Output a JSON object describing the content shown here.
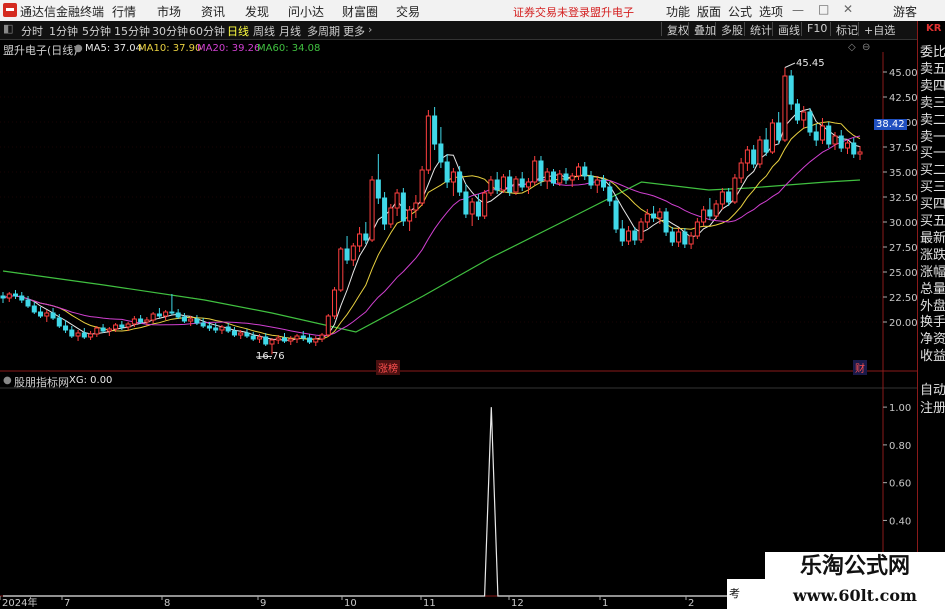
{
  "titlebar": {
    "app_name": "通达信金融终端",
    "menus": [
      "行情",
      "市场",
      "资讯",
      "发现",
      "问小达",
      "财富圈",
      "交易"
    ],
    "broker_notice": "证券交易未登录",
    "stock_name": "盟升电子",
    "right_menus": [
      "功能",
      "版面",
      "公式",
      "选项"
    ],
    "guest": "游客"
  },
  "periods": {
    "items": [
      "分时",
      "1分钟",
      "5分钟",
      "15分钟",
      "30分钟",
      "60分钟",
      "日线",
      "周线",
      "月线",
      "多周期",
      "更多"
    ],
    "active": "日线",
    "tools": [
      "复权",
      "叠加",
      "多股",
      "统计",
      "画线",
      "F10",
      "标记",
      "+自选"
    ]
  },
  "main_legend": {
    "title": "盟升电子(日线)",
    "ma5": "MA5: 37.04",
    "ma10": "MA10: 37.90",
    "ma20": "MA20: 39.26",
    "ma60": "MA60: 34.08"
  },
  "sub_legend": {
    "title": "股朋指标网",
    "xg": "XG: 0.00"
  },
  "sidebar": {
    "tag": "KR",
    "items": [
      "委比",
      "卖五",
      "卖四",
      "卖三",
      "卖二",
      "卖一",
      "买一",
      "买二",
      "买三",
      "买四",
      "买五",
      "最新",
      "涨跌",
      "涨幅",
      "总量",
      "外盘",
      "换手",
      "净资",
      "收益",
      "自动",
      "注册"
    ]
  },
  "annotations": {
    "high": "45.45",
    "low": "16.76",
    "zhangbang": "涨榜",
    "cai": "财",
    "last_price": "38.42"
  },
  "watermark": {
    "cn": "乐淘公式网",
    "url": "www.60lt.com",
    "side": "考"
  },
  "colors": {
    "up": "#ff4040",
    "down": "#40d8e8",
    "ma5": "#e8e8e8",
    "ma10": "#e8d040",
    "ma20": "#d040d0",
    "ma60": "#40c040",
    "bg": "#000000",
    "grid": "#8a1a1a"
  },
  "chart_data": [
    {
      "type": "candlestick",
      "title": "盟升电子(日线)",
      "y_ticks": [
        20,
        22.5,
        25,
        27.5,
        30,
        32.5,
        35,
        37.5,
        40,
        42.5,
        45
      ],
      "ylim": [
        16,
        47
      ],
      "x_labels": [
        "2024年",
        "7",
        "8",
        "9",
        "10",
        "11",
        "12",
        "1",
        "2"
      ],
      "ohlc": [
        [
          22.6,
          23.0,
          21.9,
          22.4
        ],
        [
          22.4,
          23.0,
          22.0,
          22.8
        ],
        [
          22.8,
          23.2,
          22.3,
          22.6
        ],
        [
          22.6,
          23.0,
          21.9,
          22.2
        ],
        [
          22.2,
          22.6,
          21.4,
          21.6
        ],
        [
          21.6,
          22.0,
          20.8,
          21.0
        ],
        [
          21.0,
          21.5,
          20.4,
          20.6
        ],
        [
          20.6,
          21.2,
          20.0,
          20.9
        ],
        [
          20.9,
          21.4,
          20.2,
          20.4
        ],
        [
          20.4,
          20.8,
          19.4,
          19.6
        ],
        [
          19.6,
          20.2,
          18.9,
          19.2
        ],
        [
          19.2,
          19.6,
          18.4,
          18.6
        ],
        [
          18.6,
          19.2,
          18.1,
          18.9
        ],
        [
          18.9,
          19.4,
          18.3,
          18.5
        ],
        [
          18.5,
          19.1,
          18.2,
          18.8
        ],
        [
          18.8,
          19.6,
          18.5,
          19.4
        ],
        [
          19.4,
          19.8,
          18.9,
          19.1
        ],
        [
          19.1,
          19.5,
          18.6,
          19.3
        ],
        [
          19.3,
          19.9,
          19.0,
          19.7
        ],
        [
          19.7,
          20.1,
          19.2,
          19.5
        ],
        [
          19.5,
          20.0,
          19.1,
          19.8
        ],
        [
          19.8,
          20.6,
          19.5,
          20.3
        ],
        [
          20.3,
          20.7,
          19.8,
          20.0
        ],
        [
          20.0,
          20.5,
          19.6,
          20.2
        ],
        [
          20.2,
          21.0,
          19.9,
          20.8
        ],
        [
          20.8,
          21.4,
          20.4,
          20.6
        ],
        [
          20.6,
          21.2,
          20.2,
          21.0
        ],
        [
          21.0,
          22.8,
          20.7,
          20.9
        ],
        [
          20.9,
          21.3,
          20.3,
          20.5
        ],
        [
          20.5,
          20.9,
          19.9,
          20.1
        ],
        [
          20.1,
          20.6,
          19.6,
          20.3
        ],
        [
          20.3,
          20.7,
          19.7,
          19.9
        ],
        [
          19.9,
          20.4,
          19.4,
          19.6
        ],
        [
          19.6,
          20.0,
          19.1,
          19.4
        ],
        [
          19.4,
          19.9,
          18.9,
          19.2
        ],
        [
          19.2,
          19.7,
          18.8,
          19.5
        ],
        [
          19.5,
          19.9,
          18.9,
          19.1
        ],
        [
          19.1,
          19.5,
          18.5,
          18.7
        ],
        [
          18.7,
          19.2,
          18.3,
          18.9
        ],
        [
          18.9,
          19.3,
          18.4,
          18.6
        ],
        [
          18.6,
          19.0,
          18.1,
          18.3
        ],
        [
          18.3,
          18.8,
          17.9,
          18.5
        ],
        [
          18.5,
          18.9,
          17.6,
          17.8
        ],
        [
          17.8,
          18.4,
          16.76,
          18.2
        ],
        [
          18.2,
          18.7,
          17.8,
          18.4
        ],
        [
          18.4,
          18.9,
          17.9,
          18.1
        ],
        [
          18.1,
          18.6,
          17.7,
          18.3
        ],
        [
          18.3,
          18.8,
          17.9,
          18.6
        ],
        [
          18.6,
          19.1,
          18.1,
          18.4
        ],
        [
          18.4,
          18.8,
          17.8,
          18.0
        ],
        [
          18.0,
          18.6,
          17.6,
          18.3
        ],
        [
          18.3,
          18.9,
          18.0,
          18.7
        ],
        [
          18.7,
          20.8,
          18.5,
          20.6
        ],
        [
          20.6,
          23.5,
          20.3,
          23.2
        ],
        [
          23.2,
          27.5,
          23.0,
          27.3
        ],
        [
          27.3,
          28.6,
          25.8,
          26.2
        ],
        [
          26.2,
          27.9,
          25.6,
          27.6
        ],
        [
          27.6,
          29.5,
          27.0,
          28.8
        ],
        [
          28.8,
          30.0,
          27.8,
          28.2
        ],
        [
          28.2,
          34.6,
          28.0,
          34.2
        ],
        [
          34.2,
          36.8,
          31.8,
          32.4
        ],
        [
          32.4,
          33.0,
          29.2,
          29.8
        ],
        [
          29.8,
          31.8,
          29.4,
          31.4
        ],
        [
          31.4,
          33.3,
          30.6,
          32.9
        ],
        [
          32.9,
          33.4,
          29.6,
          30.1
        ],
        [
          30.1,
          31.6,
          29.1,
          31.2
        ],
        [
          31.2,
          32.7,
          30.4,
          31.9
        ],
        [
          31.9,
          35.6,
          31.6,
          35.2
        ],
        [
          35.2,
          41.2,
          34.8,
          40.6
        ],
        [
          40.6,
          41.5,
          37.2,
          37.8
        ],
        [
          37.8,
          39.5,
          35.4,
          36.0
        ],
        [
          36.0,
          36.8,
          33.4,
          34.0
        ],
        [
          34.0,
          35.4,
          32.6,
          35.0
        ],
        [
          35.0,
          35.6,
          32.6,
          33.0
        ],
        [
          33.0,
          33.8,
          30.4,
          30.8
        ],
        [
          30.8,
          32.4,
          29.6,
          32.0
        ],
        [
          32.0,
          32.8,
          30.2,
          30.6
        ],
        [
          30.6,
          33.2,
          30.3,
          32.9
        ],
        [
          32.9,
          34.6,
          32.6,
          34.2
        ],
        [
          34.2,
          35.0,
          32.8,
          33.2
        ],
        [
          33.2,
          34.8,
          32.9,
          34.5
        ],
        [
          34.5,
          35.2,
          32.6,
          33.0
        ],
        [
          33.0,
          34.6,
          32.7,
          34.3
        ],
        [
          34.3,
          35.0,
          33.1,
          33.5
        ],
        [
          33.5,
          34.4,
          32.8,
          34.0
        ],
        [
          34.0,
          36.6,
          33.7,
          36.1
        ],
        [
          36.1,
          36.6,
          33.6,
          34.1
        ],
        [
          34.1,
          35.4,
          33.3,
          35.0
        ],
        [
          35.0,
          35.3,
          33.6,
          33.9
        ],
        [
          33.9,
          35.2,
          33.6,
          34.8
        ],
        [
          34.8,
          35.4,
          33.8,
          34.2
        ],
        [
          34.2,
          34.9,
          33.5,
          34.6
        ],
        [
          34.6,
          35.9,
          34.2,
          35.5
        ],
        [
          35.5,
          36.0,
          34.2,
          34.6
        ],
        [
          34.6,
          35.1,
          33.3,
          33.7
        ],
        [
          33.7,
          34.6,
          32.9,
          34.2
        ],
        [
          34.2,
          34.7,
          33.1,
          33.5
        ],
        [
          33.5,
          34.0,
          31.6,
          32.1
        ],
        [
          32.1,
          32.6,
          28.9,
          29.3
        ],
        [
          29.3,
          30.2,
          27.6,
          28.1
        ],
        [
          28.1,
          29.6,
          27.7,
          29.1
        ],
        [
          29.1,
          29.5,
          27.7,
          28.2
        ],
        [
          28.2,
          30.4,
          27.9,
          30.0
        ],
        [
          30.0,
          31.3,
          29.4,
          30.8
        ],
        [
          30.8,
          31.6,
          30.0,
          30.4
        ],
        [
          30.4,
          31.4,
          29.8,
          31.0
        ],
        [
          31.0,
          31.4,
          28.6,
          29.0
        ],
        [
          29.0,
          29.5,
          27.6,
          28.0
        ],
        [
          28.0,
          29.4,
          27.5,
          29.0
        ],
        [
          29.0,
          29.4,
          27.4,
          27.8
        ],
        [
          27.8,
          29.0,
          27.3,
          28.6
        ],
        [
          28.6,
          30.4,
          28.3,
          30.0
        ],
        [
          30.0,
          31.6,
          29.6,
          31.2
        ],
        [
          31.2,
          32.4,
          30.2,
          30.6
        ],
        [
          30.6,
          32.2,
          30.3,
          31.8
        ],
        [
          31.8,
          33.4,
          31.2,
          33.0
        ],
        [
          33.0,
          33.4,
          31.6,
          32.0
        ],
        [
          32.0,
          34.8,
          31.8,
          34.4
        ],
        [
          34.4,
          36.4,
          33.9,
          35.9
        ],
        [
          35.9,
          37.6,
          35.1,
          37.2
        ],
        [
          37.2,
          37.7,
          35.4,
          35.8
        ],
        [
          35.8,
          38.6,
          35.4,
          38.2
        ],
        [
          38.2,
          39.4,
          36.6,
          37.0
        ],
        [
          37.0,
          40.3,
          36.8,
          39.9
        ],
        [
          39.9,
          41.0,
          37.8,
          38.2
        ],
        [
          38.2,
          45.45,
          38.0,
          44.6
        ],
        [
          44.6,
          45.2,
          41.2,
          41.8
        ],
        [
          41.8,
          42.3,
          39.8,
          40.2
        ],
        [
          40.2,
          41.6,
          39.4,
          41.0
        ],
        [
          41.0,
          41.4,
          38.6,
          39.0
        ],
        [
          39.0,
          39.8,
          37.6,
          38.2
        ],
        [
          38.2,
          40.4,
          37.8,
          39.6
        ],
        [
          39.6,
          40.0,
          37.4,
          37.8
        ],
        [
          37.8,
          39.0,
          37.2,
          38.6
        ],
        [
          38.6,
          39.2,
          37.0,
          37.4
        ],
        [
          37.4,
          38.2,
          36.8,
          37.9
        ],
        [
          37.9,
          38.4,
          36.4,
          36.8
        ],
        [
          36.8,
          37.6,
          36.2,
          37.0
        ]
      ],
      "ma60_path": [
        [
          0,
          25.1
        ],
        [
          30,
          23.7
        ],
        [
          60,
          22.2
        ],
        [
          80,
          20.9
        ],
        [
          105,
          19.0
        ],
        [
          125,
          22.6
        ],
        [
          145,
          26.4
        ],
        [
          170,
          30.6
        ],
        [
          190,
          34.0
        ],
        [
          210,
          33.2
        ],
        [
          222,
          33.4
        ],
        [
          245,
          34.0
        ],
        [
          255,
          34.2
        ]
      ]
    },
    {
      "type": "line",
      "title": "股朋指标网",
      "series": [
        {
          "name": "XG",
          "values": [
            0,
            0,
            1,
            0,
            0
          ]
        }
      ],
      "x": [
        0,
        145,
        147,
        149,
        258
      ],
      "y_ticks": [
        0.4,
        0.6,
        0.8,
        1.0
      ],
      "ylim": [
        0,
        1.08
      ]
    }
  ]
}
